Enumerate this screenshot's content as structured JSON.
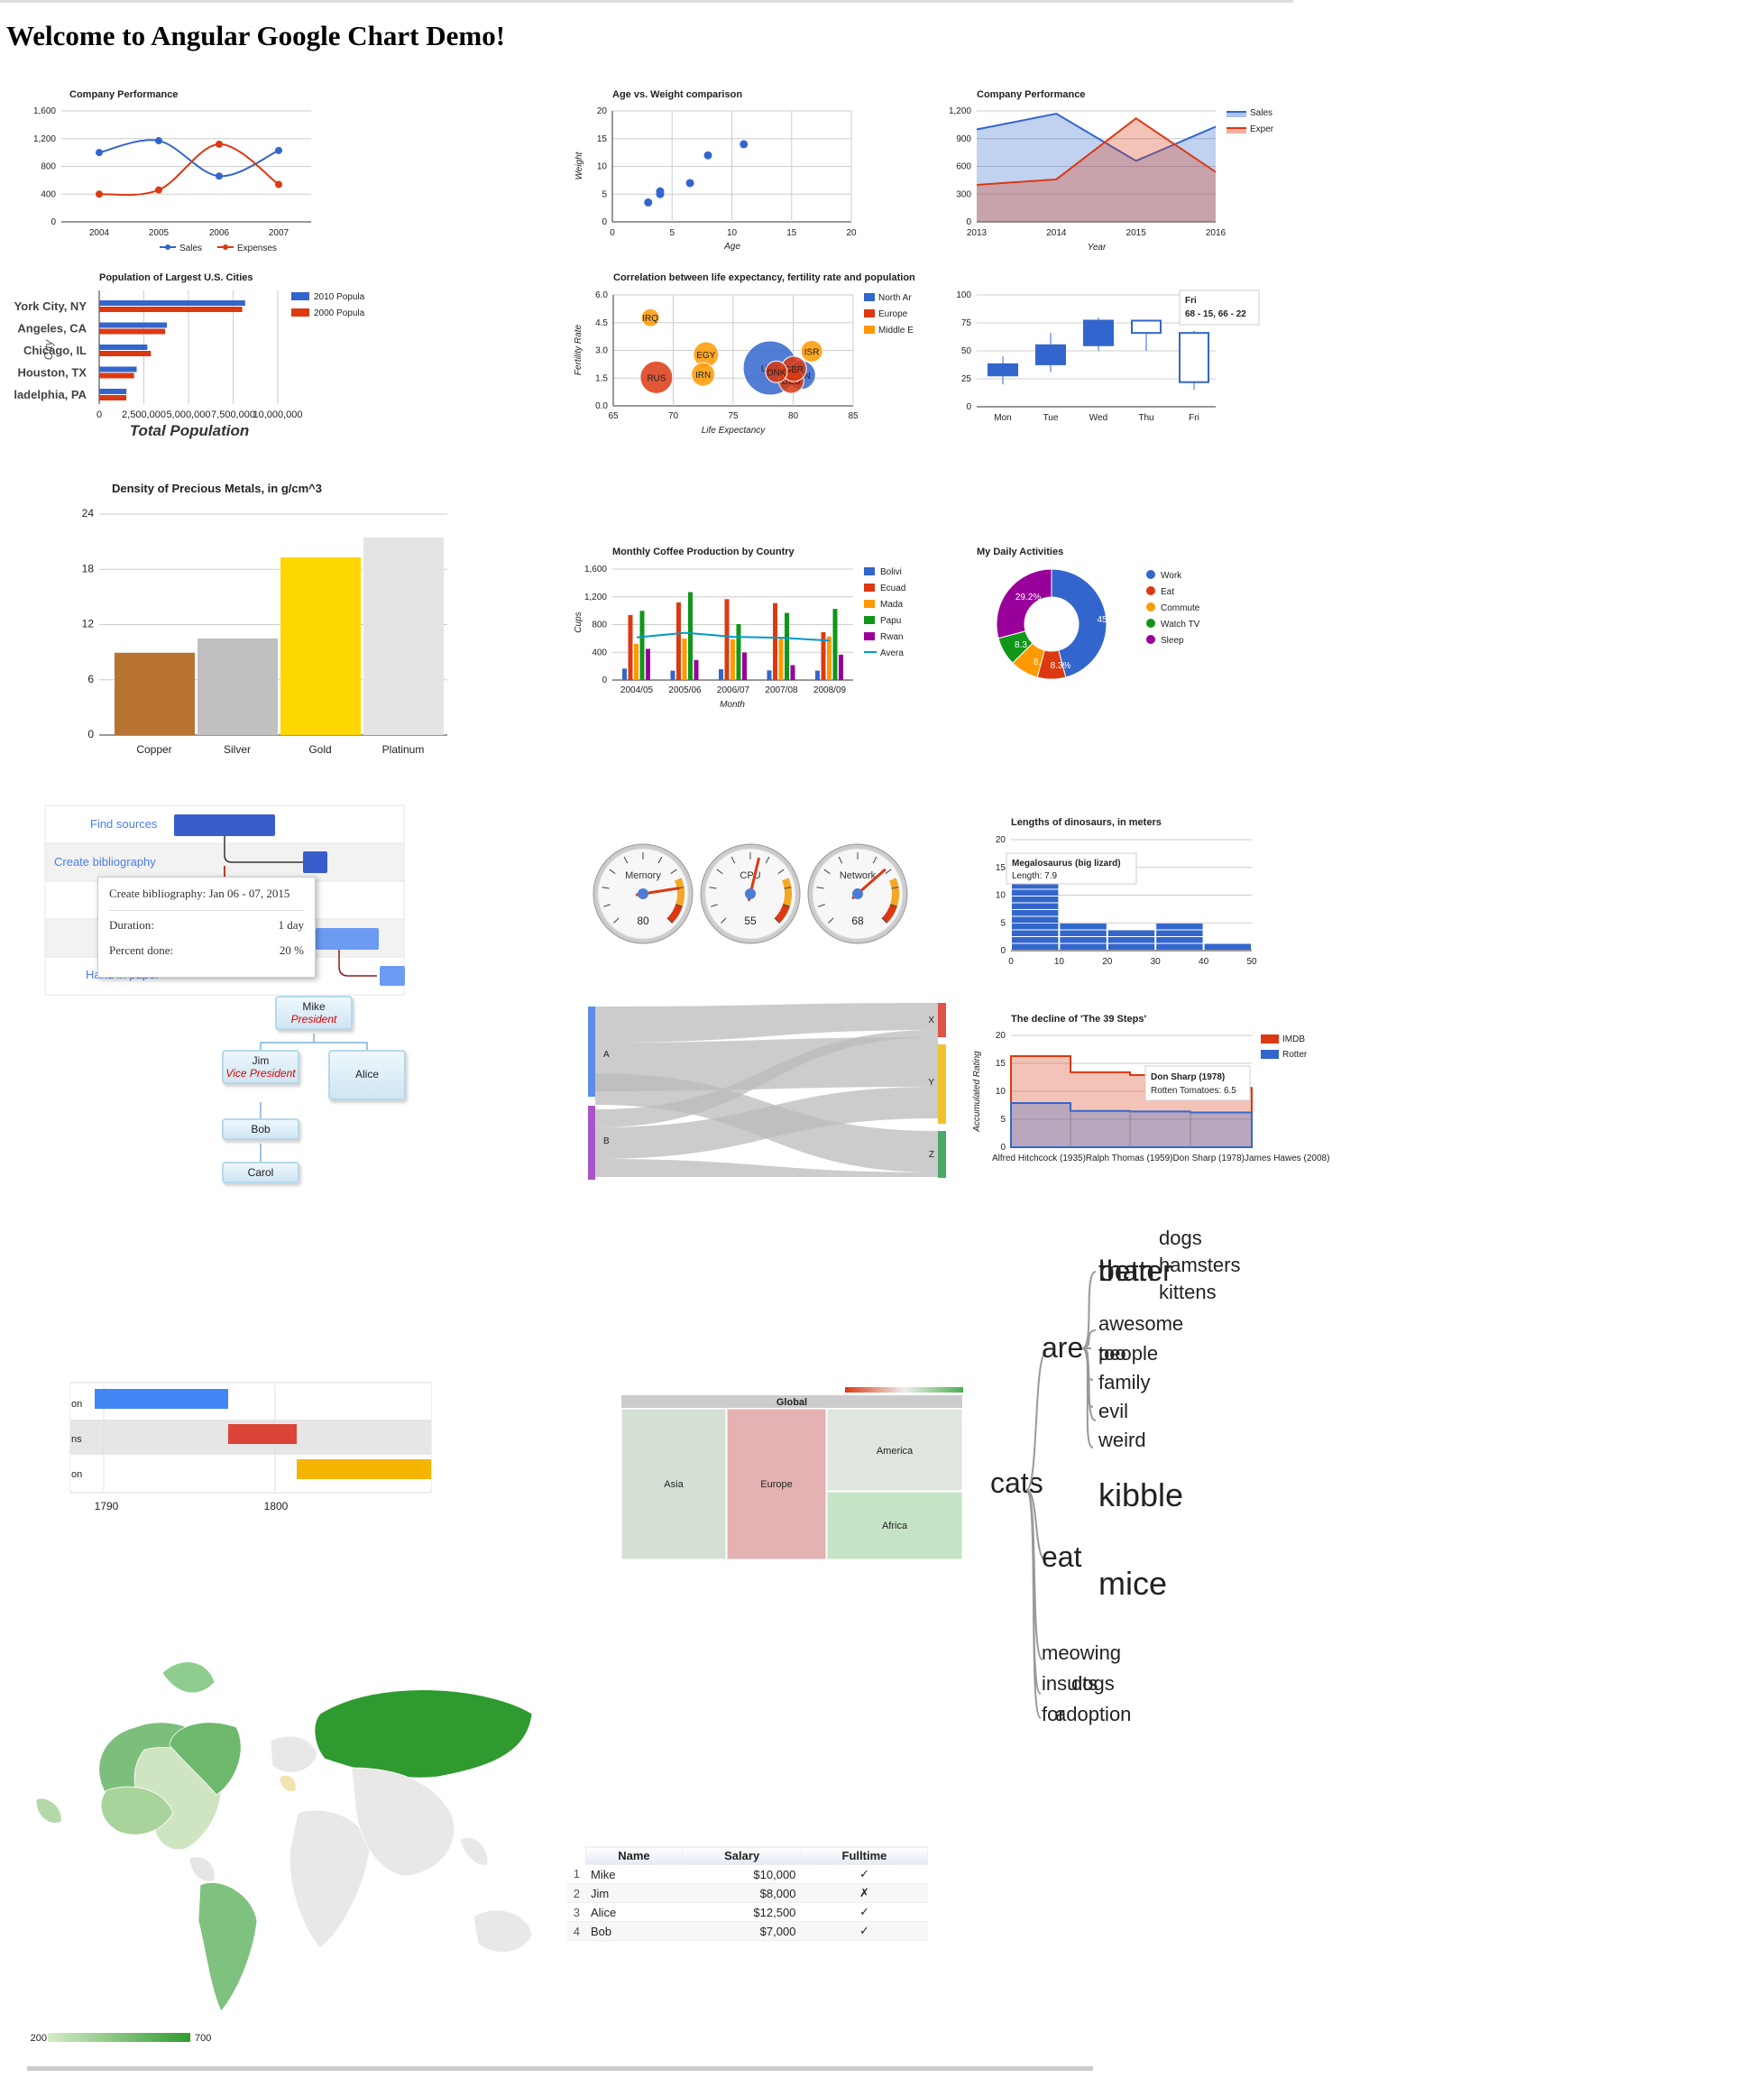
{
  "page": {
    "heading": "Welcome to Angular Google Chart Demo!"
  },
  "chart_data": [
    {
      "id": "perf-line",
      "type": "line",
      "title": "Company Performance",
      "categories": [
        "2004",
        "2005",
        "2006",
        "2007"
      ],
      "series": [
        {
          "name": "Sales",
          "values": [
            1000,
            1170,
            660,
            1030
          ],
          "color": "#3366cc"
        },
        {
          "name": "Expenses",
          "values": [
            400,
            460,
            1120,
            540
          ],
          "color": "#dc3912"
        }
      ],
      "ylim": [
        0,
        1600
      ],
      "yticks": [
        "0",
        "400",
        "800",
        "1,200",
        "1,600"
      ],
      "smooth": true,
      "legend": "bottom",
      "grid": true
    },
    {
      "id": "age-scatter",
      "type": "scatter",
      "title": "Age vs. Weight comparison",
      "xlabel": "Age",
      "ylabel": "Weight",
      "points": [
        [
          8,
          12
        ],
        [
          4,
          5.5
        ],
        [
          11,
          14
        ],
        [
          4,
          5
        ],
        [
          3,
          3.5
        ],
        [
          6.5,
          7
        ]
      ],
      "xlim": [
        0,
        20
      ],
      "ylim": [
        0,
        20
      ],
      "xticks": [
        "0",
        "5",
        "10",
        "15",
        "20"
      ],
      "yticks": [
        "0",
        "5",
        "10",
        "15",
        "20"
      ],
      "color": "#3366cc",
      "grid": true
    },
    {
      "id": "perf-area",
      "type": "area",
      "title": "Company Performance",
      "xlabel": "Year",
      "categories": [
        "2013",
        "2014",
        "2015",
        "2016"
      ],
      "series": [
        {
          "name": "Sales",
          "values": [
            1000,
            1170,
            660,
            1030
          ],
          "color": "#3366cc"
        },
        {
          "name": "Expenses",
          "values": [
            400,
            460,
            1120,
            540
          ],
          "color": "#dc3912"
        }
      ],
      "ylim": [
        0,
        1200
      ],
      "yticks": [
        "0",
        "300",
        "600",
        "900",
        "1,200"
      ],
      "legend": "right",
      "legend_labels": [
        "Sales",
        "Exper"
      ]
    },
    {
      "id": "population-bar",
      "type": "bar",
      "orientation": "horizontal",
      "title": "Population of Largest U.S. Cities",
      "xlabel": "Total Population",
      "ylabel": "City",
      "categories": [
        "York City, NY",
        "Angeles, CA",
        "Chicago, IL",
        "Houston, TX",
        "ladelphia, PA"
      ],
      "series": [
        {
          "name": "2010 Popula",
          "values": [
            8175000,
            3792000,
            2695000,
            2099000,
            1526000
          ],
          "color": "#3366cc"
        },
        {
          "name": "2000 Popula",
          "values": [
            8008000,
            3694000,
            2896000,
            1953000,
            1517000
          ],
          "color": "#dc3912"
        }
      ],
      "xlim": [
        0,
        10000000
      ],
      "xticks": [
        "0",
        "2,500,000",
        "5,000,000",
        "7,500,000",
        "10,000,000"
      ],
      "legend": "right"
    },
    {
      "id": "life-bubble",
      "type": "scatter",
      "subtype": "bubble",
      "title": "Correlation between life expectancy, fertility rate and population",
      "xlabel": "Life Expectancy",
      "ylabel": "Fertility Rate",
      "xlim": [
        65,
        85
      ],
      "ylim": [
        0,
        6
      ],
      "xticks": [
        "65",
        "70",
        "75",
        "80",
        "85"
      ],
      "yticks": [
        "0.0",
        "1.5",
        "3.0",
        "4.5",
        "6.0"
      ],
      "legend_entries": [
        {
          "name": "North Ar",
          "color": "#3366cc"
        },
        {
          "name": "Europe",
          "color": "#dc3912"
        },
        {
          "name": "Middle E",
          "color": "#ff9900"
        }
      ],
      "bubbles": [
        {
          "label": "CAN",
          "x": 80.66,
          "y": 1.67,
          "r": 16,
          "color": "#3366cc"
        },
        {
          "label": "DEU",
          "x": 79.84,
          "y": 1.36,
          "r": 14,
          "color": "#dc3912"
        },
        {
          "label": "DNK",
          "x": 78.6,
          "y": 1.84,
          "r": 12,
          "color": "#dc3912"
        },
        {
          "label": "EGY",
          "x": 72.73,
          "y": 2.78,
          "r": 14,
          "color": "#ff9900"
        },
        {
          "label": "GBR",
          "x": 80.05,
          "y": 2,
          "r": 14,
          "color": "#dc3912"
        },
        {
          "label": "IRN",
          "x": 72.49,
          "y": 1.7,
          "r": 13,
          "color": "#ff9900"
        },
        {
          "label": "IRQ",
          "x": 68.09,
          "y": 4.77,
          "r": 10,
          "color": "#ff9900"
        },
        {
          "label": "ISR",
          "x": 81.55,
          "y": 2.96,
          "r": 12,
          "color": "#ff9900"
        },
        {
          "label": "RUS",
          "x": 68.6,
          "y": 1.54,
          "r": 18,
          "color": "#dc3912"
        },
        {
          "label": "USA",
          "x": 78.09,
          "y": 2.05,
          "r": 30,
          "color": "#3366cc"
        }
      ]
    },
    {
      "id": "candlestick",
      "type": "candlestick",
      "categories": [
        "Mon",
        "Tue",
        "Wed",
        "Thu",
        "Fri"
      ],
      "values": [
        [
          20,
          28,
          38,
          45
        ],
        [
          31,
          38,
          55,
          66
        ],
        [
          50,
          55,
          77,
          80
        ],
        [
          77,
          77,
          66,
          50
        ],
        [
          68,
          66,
          22,
          15
        ]
      ],
      "ylim": [
        0,
        100
      ],
      "yticks": [
        "0",
        "25",
        "50",
        "75",
        "100"
      ],
      "tooltip": {
        "title": "Fri",
        "value": "68 - 15, 66 - 22"
      }
    },
    {
      "id": "metals-column",
      "type": "bar",
      "title": "Density of Precious Metals, in g/cm^3",
      "categories": [
        "Copper",
        "Silver",
        "Gold",
        "Platinum"
      ],
      "values": [
        8.94,
        10.49,
        19.3,
        21.45
      ],
      "colors": [
        "#b87333",
        "#c0c0c0",
        "#ffd700",
        "#e5e4e2"
      ],
      "ylim": [
        0,
        24
      ],
      "yticks": [
        "0",
        "6",
        "12",
        "18",
        "24"
      ]
    },
    {
      "id": "coffee-combo",
      "type": "bar",
      "title": "Monthly Coffee Production by Country",
      "xlabel": "Month",
      "ylabel": "Cups",
      "categories": [
        "2004/05",
        "2005/06",
        "2006/07",
        "2007/08",
        "2008/09"
      ],
      "series": [
        {
          "name": "Bolivia",
          "values": [
            165,
            135,
            157,
            139,
            136
          ],
          "color": "#3366cc"
        },
        {
          "name": "Ecuador",
          "values": [
            938,
            1120,
            1167,
            1110,
            691
          ],
          "color": "#dc3912"
        },
        {
          "name": "Madagascar",
          "values": [
            522,
            599,
            587,
            615,
            629
          ],
          "color": "#ff9900"
        },
        {
          "name": "Papua New Guinea",
          "values": [
            998,
            1268,
            807,
            968,
            1026
          ],
          "color": "#109618"
        },
        {
          "name": "Rwanda",
          "values": [
            450,
            288,
            397,
            215,
            366
          ],
          "color": "#990099"
        }
      ],
      "line": {
        "name": "Average",
        "values": [
          614.6,
          682,
          623,
          609.4,
          569.6
        ],
        "color": "#0099c6"
      },
      "legend_labels": [
        "Bolivi",
        "Ecuad",
        "Mada",
        "Papu",
        "Rwan",
        "Avera"
      ],
      "ylim": [
        0,
        1600
      ],
      "yticks": [
        "0",
        "400",
        "800",
        "1,200",
        "1,600"
      ]
    },
    {
      "id": "activities-donut",
      "type": "pie",
      "subtype": "donut",
      "title": "My Daily Activities",
      "categories": [
        "Work",
        "Eat",
        "Commute",
        "Watch TV",
        "Sleep"
      ],
      "values": [
        11,
        2,
        2,
        2,
        7
      ],
      "colors": [
        "#3366cc",
        "#dc3912",
        "#ff9900",
        "#109618",
        "#990099"
      ],
      "slice_labels": [
        "45",
        "8.3%",
        "8.",
        "8.3",
        "29.2%"
      ],
      "legend": "right"
    },
    {
      "id": "dino-histogram",
      "type": "bar",
      "subtype": "histogram",
      "title": "Lengths of dinosaurs, in meters",
      "xlim": [
        0,
        50
      ],
      "ylim": [
        0,
        20
      ],
      "xticks": [
        "0",
        "10",
        "20",
        "30",
        "40",
        "50"
      ],
      "yticks": [
        "0",
        "5",
        "10",
        "15",
        "20"
      ],
      "bins": [
        {
          "from": 0,
          "to": 10,
          "count": 11
        },
        {
          "from": 10,
          "to": 20,
          "count": 4
        },
        {
          "from": 20,
          "to": 30,
          "count": 3
        },
        {
          "from": 30,
          "to": 40,
          "count": 4
        },
        {
          "from": 40,
          "to": 50,
          "count": 1
        }
      ],
      "tooltip": {
        "title": "Megalosaurus (big lizard)",
        "label": "Length:",
        "value": "7.9"
      }
    },
    {
      "id": "steps-stepped",
      "type": "area",
      "subtype": "stepped",
      "title": "The decline of 'The 39 Steps'",
      "ylabel": "Accumulated Rating",
      "categories": [
        "Alfred Hitchcock (1935)",
        "Ralph Thomas (1959)",
        "Don Sharp (1978)",
        "James Hawes (2008)"
      ],
      "category_text": "Alfred Hitchcock (1935)Ralph Thomas (1959)Don Sharp (1978)James Hawes (2008)",
      "series": [
        {
          "name": "IMDB",
          "values": [
            8.4,
            6.9,
            6.5,
            4.4
          ],
          "color": "#dc3912"
        },
        {
          "name": "Rotten Tomatoes",
          "values": [
            7.9,
            6.5,
            6.4,
            6.2
          ],
          "color": "#3366cc"
        }
      ],
      "legend_labels": [
        "IMDB",
        "Rotter"
      ],
      "ylim": [
        0,
        20
      ],
      "yticks": [
        "0",
        "5",
        "10",
        "15",
        "20"
      ],
      "tooltip": {
        "title": "Don Sharp (1978)",
        "label": "Rotten Tomatoes:",
        "value": "6.5"
      }
    }
  ],
  "gantt": {
    "rows": [
      "Find sources",
      "Create bibliography",
      "C",
      "",
      "Hand in paper"
    ],
    "tooltip": {
      "title": "Create bibliography: Jan 06 - 07, 2015",
      "duration_label": "Duration:",
      "duration": "1 day",
      "percent_label": "Percent done:",
      "percent": "20 %"
    }
  },
  "gauges": [
    {
      "label": "Memory",
      "value": 80
    },
    {
      "label": "CPU",
      "value": 55
    },
    {
      "label": "Network",
      "value": 68
    }
  ],
  "org": {
    "nodes": [
      {
        "name": "Mike",
        "title": "President"
      },
      {
        "name": "Jim",
        "title": "Vice President"
      },
      {
        "name": "Alice",
        "title": ""
      },
      {
        "name": "Bob",
        "title": ""
      },
      {
        "name": "Carol",
        "title": ""
      }
    ]
  },
  "sankey": {
    "sources": [
      "A",
      "B"
    ],
    "targets": [
      "X",
      "Y",
      "Z"
    ],
    "links": [
      {
        "from": "A",
        "to": "X",
        "weight": 5
      },
      {
        "from": "A",
        "to": "Y",
        "weight": 7
      },
      {
        "from": "A",
        "to": "Z",
        "weight": 6
      },
      {
        "from": "B",
        "to": "X",
        "weight": 2
      },
      {
        "from": "B",
        "to": "Y",
        "weight": 9
      },
      {
        "from": "B",
        "to": "Z",
        "weight": 4
      }
    ],
    "colors": {
      "A": "#5c8ee6",
      "B": "#a855c7",
      "X": "#e0534a",
      "Y": "#f2c12e",
      "Z": "#4aa86a"
    }
  },
  "wordtree": {
    "root": "cats",
    "branches": [
      "are",
      "eat",
      "meowing",
      "insults",
      "adoption"
    ],
    "words": [
      "dogs",
      "hamsters",
      "kittens",
      "better",
      "than",
      "awesome",
      "people",
      "too",
      "family",
      "evil",
      "weird",
      "kibble",
      "mice",
      "meowing",
      "insults",
      "dogs",
      "for",
      "adoption"
    ]
  },
  "timeline": {
    "row_labels": [
      "on",
      "ns",
      "on"
    ],
    "ticks": [
      "1790",
      "1800"
    ],
    "bars": [
      {
        "color": "#4285f4"
      },
      {
        "color": "#db4437"
      },
      {
        "color": "#f4b400"
      }
    ]
  },
  "treemap": {
    "title": "Global",
    "cells": [
      "Asia",
      "Europe",
      "America",
      "Africa"
    ]
  },
  "geochart": {
    "min": "200",
    "max": "700"
  },
  "table": {
    "headers": [
      "Name",
      "Salary",
      "Fulltime"
    ],
    "rows": [
      {
        "idx": "1",
        "name": "Mike",
        "salary": "$10,000",
        "fulltime": "✓"
      },
      {
        "idx": "2",
        "name": "Jim",
        "salary": "$8,000",
        "fulltime": "✗"
      },
      {
        "idx": "3",
        "name": "Alice",
        "salary": "$12,500",
        "fulltime": "✓"
      },
      {
        "idx": "4",
        "name": "Bob",
        "salary": "$7,000",
        "fulltime": "✓"
      }
    ]
  }
}
